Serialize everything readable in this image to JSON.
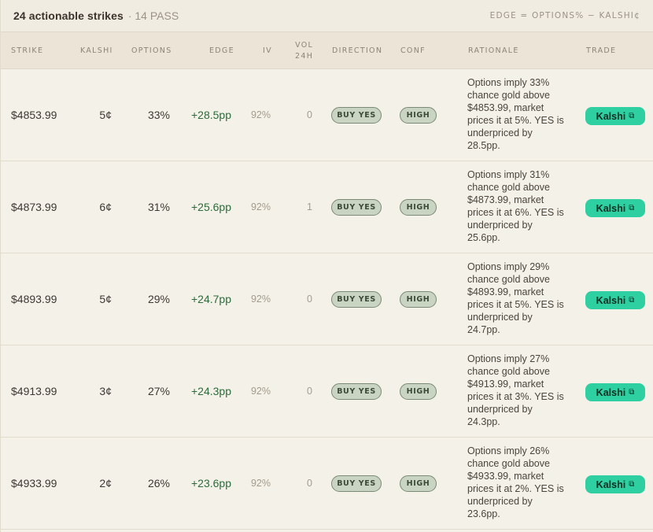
{
  "header": {
    "title": "24 actionable strikes",
    "pass": "· 14 PASS",
    "formula": "EDGE = OPTIONS% − KALSHI¢"
  },
  "columns": {
    "strike": "STRIKE",
    "kalshi": "KALSHI",
    "options": "OPTIONS",
    "edge": "EDGE",
    "iv": "IV",
    "vol_line1": "VOL",
    "vol_line2": "24H",
    "direction": "DIRECTION",
    "conf": "CONF",
    "rationale": "RATIONALE",
    "trade": "TRADE"
  },
  "rows": [
    {
      "strike": "$4853.99",
      "kalshi": "5¢",
      "options": "33%",
      "edge": "+28.5pp",
      "iv": "92%",
      "vol": "0",
      "direction": "BUY YES",
      "conf": "HIGH",
      "rationale": "Options imply 33% chance gold above $4853.99, market prices it at 5%. YES is underpriced by 28.5pp.",
      "trade": "Kalshi"
    },
    {
      "strike": "$4873.99",
      "kalshi": "6¢",
      "options": "31%",
      "edge": "+25.6pp",
      "iv": "92%",
      "vol": "1",
      "direction": "BUY YES",
      "conf": "HIGH",
      "rationale": "Options imply 31% chance gold above $4873.99, market prices it at 6%. YES is underpriced by 25.6pp.",
      "trade": "Kalshi"
    },
    {
      "strike": "$4893.99",
      "kalshi": "5¢",
      "options": "29%",
      "edge": "+24.7pp",
      "iv": "92%",
      "vol": "0",
      "direction": "BUY YES",
      "conf": "HIGH",
      "rationale": "Options imply 29% chance gold above $4893.99, market prices it at 5%. YES is underpriced by 24.7pp.",
      "trade": "Kalshi"
    },
    {
      "strike": "$4913.99",
      "kalshi": "3¢",
      "options": "27%",
      "edge": "+24.3pp",
      "iv": "92%",
      "vol": "0",
      "direction": "BUY YES",
      "conf": "HIGH",
      "rationale": "Options imply 27% chance gold above $4913.99, market prices it at 3%. YES is underpriced by 24.3pp.",
      "trade": "Kalshi"
    },
    {
      "strike": "$4933.99",
      "kalshi": "2¢",
      "options": "26%",
      "edge": "+23.6pp",
      "iv": "92%",
      "vol": "0",
      "direction": "BUY YES",
      "conf": "HIGH",
      "rationale": "Options imply 26% chance gold above $4933.99, market prices it at 2%. YES is underpriced by 23.6pp.",
      "trade": "Kalshi"
    }
  ],
  "icons": {
    "trade_link": "external-link-icon"
  }
}
